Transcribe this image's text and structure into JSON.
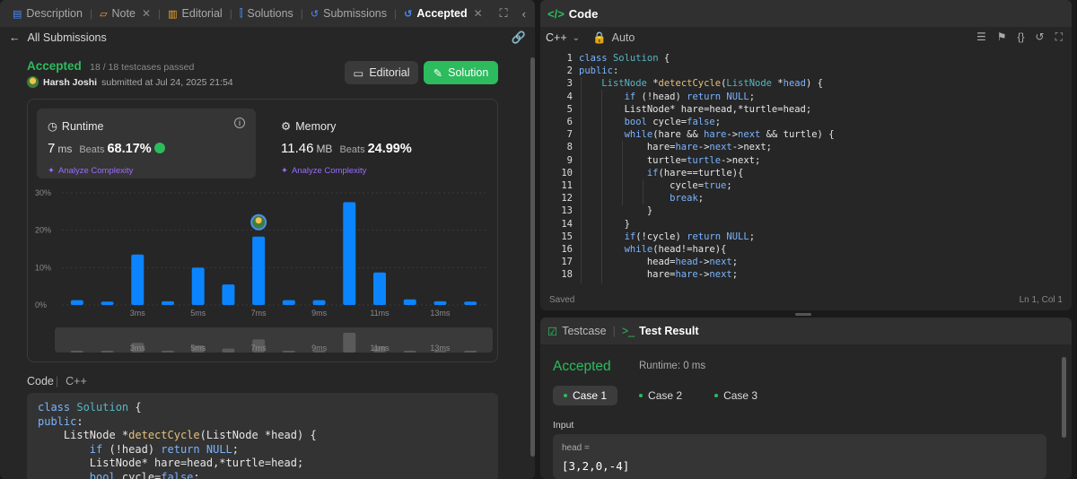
{
  "left_panel": {
    "tabs": [
      {
        "icon": "description-icon",
        "label": "Description"
      },
      {
        "icon": "note-icon",
        "label": "Note"
      },
      {
        "icon": "editorial-icon",
        "label": "Editorial"
      },
      {
        "icon": "solutions-icon",
        "label": "Solutions"
      },
      {
        "icon": "submissions-icon",
        "label": "Submissions"
      },
      {
        "icon": "accepted-icon",
        "label": "Accepted"
      }
    ],
    "back_label": "All Submissions",
    "status": "Accepted",
    "testcases": "18 / 18 testcases passed",
    "author": "Harsh Joshi",
    "submitted_text": "submitted at Jul 24, 2025 21:54",
    "editorial_button": "Editorial",
    "solution_button": "Solution",
    "runtime": {
      "title": "Runtime",
      "value": "7",
      "unit": "ms",
      "beats_label": "Beats",
      "beats": "68.17%",
      "analyze": "Analyze Complexity"
    },
    "memory": {
      "title": "Memory",
      "value": "11.46",
      "unit": "MB",
      "beats_label": "Beats",
      "beats": "24.99%",
      "analyze": "Analyze Complexity"
    },
    "code_label": "Code",
    "code_lang": "C++"
  },
  "chart_data": {
    "type": "bar",
    "y_ticks": [
      "30%",
      "20%",
      "10%",
      "0%"
    ],
    "ylim": [
      0,
      30
    ],
    "x_tick_labels": [
      "3ms",
      "5ms",
      "7ms",
      "9ms",
      "11ms",
      "13ms"
    ],
    "x": [
      1,
      2,
      3,
      4,
      5,
      6,
      7,
      8,
      9,
      10,
      11,
      12,
      13,
      14
    ],
    "values": [
      1.3,
      0.9,
      13.5,
      1.0,
      10.0,
      5.5,
      18.3,
      1.3,
      1.3,
      27.5,
      8.7,
      1.5,
      1.0,
      0.9
    ],
    "highlight_x": 7,
    "bar_color": "#0a84ff"
  },
  "right_top": {
    "title": "Code",
    "lang": "C++",
    "auto": "Auto",
    "status": "Saved",
    "cursor": "Ln 1, Col 1"
  },
  "right_bottom": {
    "tab_testcase": "Testcase",
    "tab_result": "Test Result",
    "status": "Accepted",
    "runtime": "Runtime: 0 ms",
    "cases": [
      "Case 1",
      "Case 2",
      "Case 3"
    ],
    "input_label": "Input",
    "input_name": "head =",
    "input_value": "[3,2,0,-4]"
  }
}
